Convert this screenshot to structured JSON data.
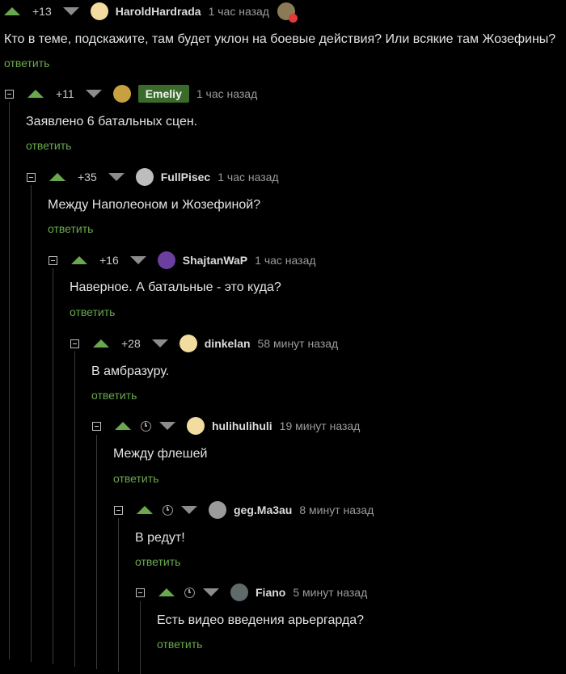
{
  "comments": [
    {
      "rating": "+13",
      "user": "HaroldHardrada",
      "time": "1 час назад",
      "text": "Кто в теме, подскажите, там будет уклон на боевые действия? Или всякие там Жозефины?",
      "reply": "ответить"
    },
    {
      "rating": "+11",
      "user": "Emeliy",
      "time": "1 час назад",
      "text": "Заявлено 6 батальных сцен.",
      "reply": "ответить"
    },
    {
      "rating": "+35",
      "user": "FullPisec",
      "time": "1 час назад",
      "text": "Между Наполеоном и Жозефиной?",
      "reply": "ответить"
    },
    {
      "rating": "+16",
      "user": "ShajtanWaP",
      "time": "1 час назад",
      "text": "Наверное. А батальные - это куда?",
      "reply": "ответить"
    },
    {
      "rating": "+28",
      "user": "dinkelan",
      "time": "58 минут назад",
      "text": "В амбразуру.",
      "reply": "ответить"
    },
    {
      "user": "hulihulihuli",
      "time": "19 минут назад",
      "text": "Между флешей",
      "reply": "ответить"
    },
    {
      "user": "geg.Ma3au",
      "time": "8 минут назад",
      "text": "В редут!",
      "reply": "ответить"
    },
    {
      "user": "Fiano",
      "time": "5 минут назад",
      "text": "Есть видео введения арьергарда?",
      "reply": "ответить"
    }
  ],
  "icons": {
    "upvote": "arrow-up-icon",
    "downvote": "arrow-down-icon",
    "collapse": "collapse-icon",
    "pending": "clock-icon"
  },
  "colors": {
    "accent": "#6aa84f",
    "background": "#000000",
    "badge": "#3a6b2a"
  }
}
